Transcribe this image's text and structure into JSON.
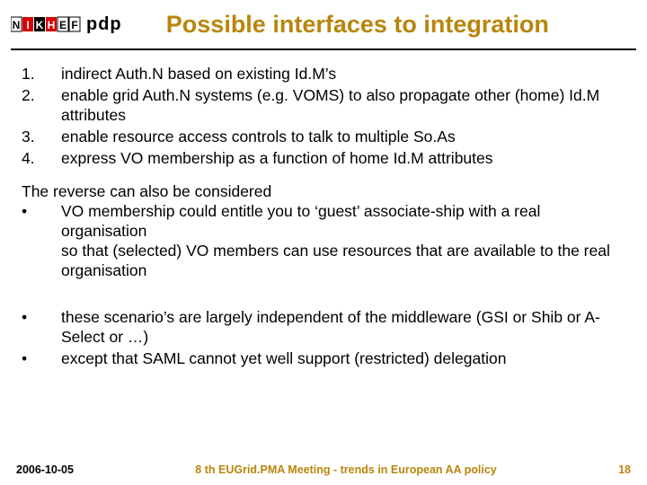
{
  "header": {
    "title": "Possible interfaces to integration",
    "logo_boxes": [
      "N",
      "I",
      "K",
      "H",
      "E",
      "F"
    ],
    "logo_suffix": "pdp"
  },
  "numbered": [
    {
      "n": "1.",
      "t": "indirect Auth.N based on existing Id.M’s"
    },
    {
      "n": "2.",
      "t": "enable grid Auth.N systems (e.g. VOMS) to also propagate other (home) Id.M attributes"
    },
    {
      "n": "3.",
      "t": "enable resource access controls to talk to multiple So.As"
    },
    {
      "n": "4.",
      "t": "express VO membership as a function of home Id.M attributes"
    }
  ],
  "section_intro": "The reverse can also be considered",
  "bullets1": [
    {
      "n": "•",
      "t": "VO membership could entitle you to ‘guest’ associate-ship with a real organisation\nso that (selected) VO members can use resources that are available to the real organisation"
    }
  ],
  "bullets2": [
    {
      "n": "•",
      "t": "these scenario’s are largely independent of the middleware (GSI or Shib or A-Select or …)"
    },
    {
      "n": "•",
      "t": "except that SAML cannot yet well support (restricted) delegation"
    }
  ],
  "footer": {
    "date": "2006-10-05",
    "mid": "8 th EUGrid.PMA Meeting - trends in European AA policy",
    "page": "18"
  }
}
